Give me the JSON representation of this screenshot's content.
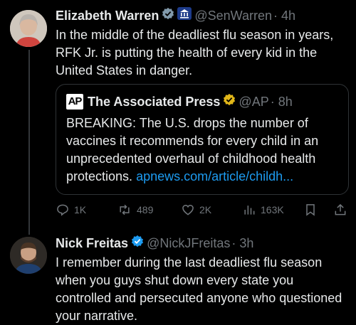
{
  "tweet1": {
    "name": "Elizabeth Warren",
    "handle": "@SenWarren",
    "time": "· 4h",
    "text": "In the middle of the deadliest flu season in years, RFK Jr. is putting the health of every kid in the United States in danger.",
    "quote": {
      "logo": "AP",
      "name": "The Associated Press",
      "handle": "@AP",
      "time": "· 8h",
      "text": "BREAKING: The U.S. drops the number of vaccines it recommends for every child in an unprecedented overhaul of childhood health protections. ",
      "link": "apnews.com/article/childh..."
    },
    "actions": {
      "replies": "1K",
      "reposts": "489",
      "likes": "2K",
      "views": "163K"
    }
  },
  "tweet2": {
    "name": "Nick Freitas",
    "handle": "@NickJFreitas",
    "time": "· 3h",
    "text": "I remember during the last deadliest flu season when you guys shut down every state you controlled and persecuted anyone who questioned your narrative."
  },
  "colors": {
    "background": "#000000",
    "text": "#e7e9ea",
    "muted": "#71767b",
    "link": "#1d9bf0",
    "verified_blue": "#1d9bf0",
    "verified_gold": "#e2b719"
  },
  "icons": [
    "verified-badge-icon",
    "government-badge-icon",
    "gold-verified-badge-icon",
    "reply-icon",
    "repost-icon",
    "like-icon",
    "views-icon",
    "bookmark-icon",
    "share-icon"
  ]
}
